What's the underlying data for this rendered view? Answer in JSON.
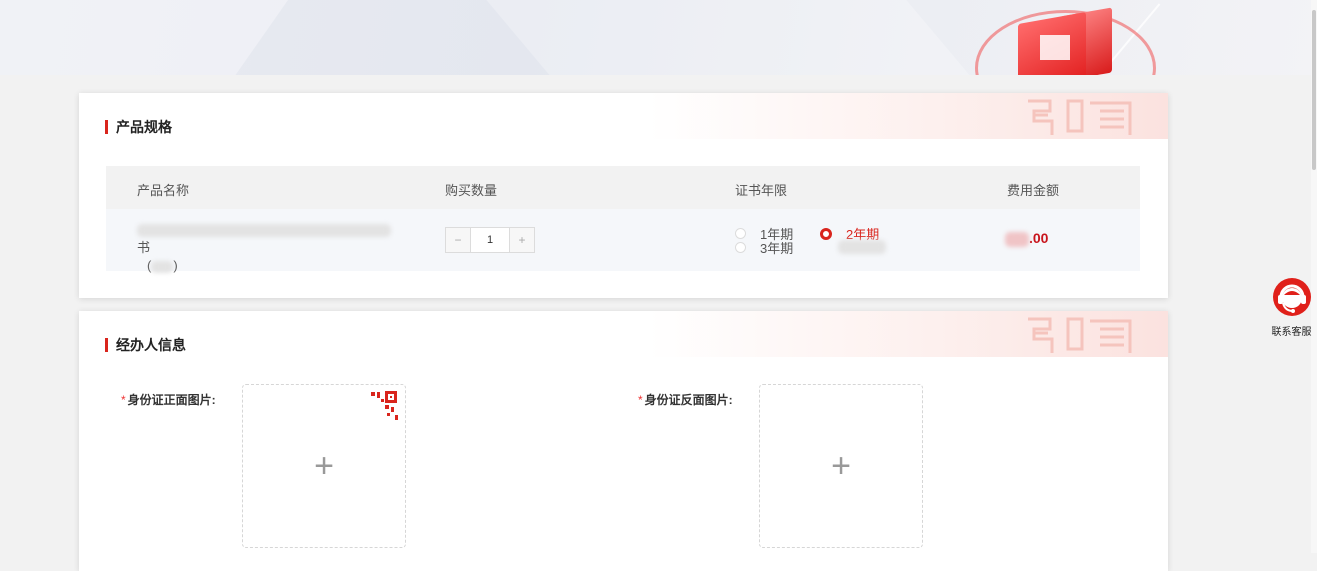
{
  "colors": {
    "accent": "#d9251d",
    "price": "#c8141c"
  },
  "product_spec": {
    "title": "产品规格",
    "columns": [
      "产品名称",
      "购买数量",
      "证书年限",
      "费用金额"
    ],
    "row": {
      "product_name_visible_suffix": "书",
      "product_name_line2_open": "(",
      "product_name_line2_close": ")",
      "quantity": "1",
      "decrement_label": "−",
      "increment_label": "+",
      "year_options": [
        {
          "label": "1年期",
          "selected": false
        },
        {
          "label": "2年期",
          "selected": true
        },
        {
          "label": "3年期",
          "selected": false
        }
      ],
      "price_visible_suffix": ".00"
    }
  },
  "agent_info": {
    "title": "经办人信息",
    "required_mark": "*",
    "id_front_label": "身份证正面图片:",
    "id_back_label": "身份证反面图片:",
    "upload_plus": "+"
  },
  "customer_service": {
    "label": "联系客服",
    "icon": "headset-icon"
  }
}
